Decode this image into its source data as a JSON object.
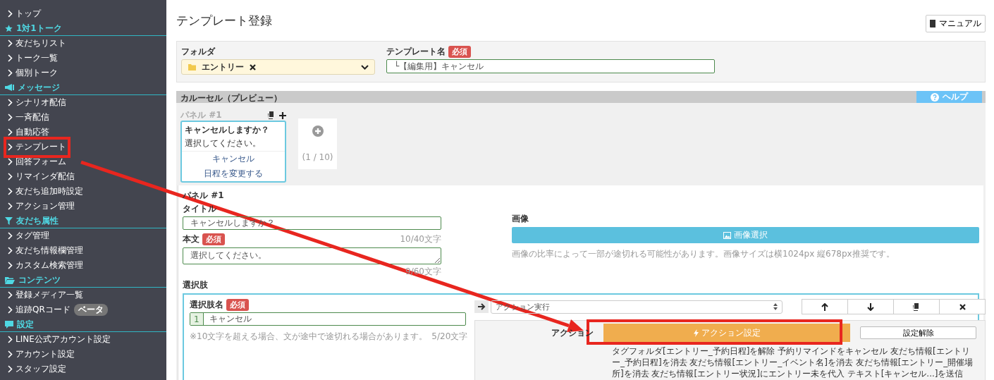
{
  "sidebar": {
    "items": [
      {
        "kind": "link",
        "label": "トップ"
      },
      {
        "kind": "section",
        "label": "1対1トーク"
      },
      {
        "kind": "link",
        "label": "友だちリスト"
      },
      {
        "kind": "link",
        "label": "トーク一覧"
      },
      {
        "kind": "link",
        "label": "個別トーク"
      },
      {
        "kind": "section",
        "label": "メッセージ"
      },
      {
        "kind": "link",
        "label": "シナリオ配信"
      },
      {
        "kind": "link",
        "label": "一斉配信"
      },
      {
        "kind": "link",
        "label": "自動応答"
      },
      {
        "kind": "link",
        "label": "テンプレート"
      },
      {
        "kind": "link",
        "label": "回答フォーム"
      },
      {
        "kind": "link",
        "label": "リマインダ配信"
      },
      {
        "kind": "link",
        "label": "友だち追加時設定"
      },
      {
        "kind": "link",
        "label": "アクション管理"
      },
      {
        "kind": "section",
        "label": "友だち属性"
      },
      {
        "kind": "link",
        "label": "タグ管理"
      },
      {
        "kind": "link",
        "label": "友だち情報欄管理"
      },
      {
        "kind": "link",
        "label": "カスタム検索管理"
      },
      {
        "kind": "section",
        "label": "コンテンツ"
      },
      {
        "kind": "link",
        "label": "登録メディア一覧"
      },
      {
        "kind": "link",
        "label": "追跡QRコード",
        "badge": "ベータ"
      },
      {
        "kind": "section",
        "label": "設定"
      },
      {
        "kind": "link",
        "label": "LINE公式アカウント設定"
      },
      {
        "kind": "link",
        "label": "アカウント設定"
      },
      {
        "kind": "link",
        "label": "スタッフ設定"
      }
    ]
  },
  "page": {
    "title": "テンプレート登録",
    "manual_button": "マニュアル"
  },
  "folder": {
    "label": "フォルダ",
    "value": "エントリー"
  },
  "template_name": {
    "label": "テンプレート名",
    "required": "必須",
    "value": "└【編集用】キャンセル"
  },
  "carousel": {
    "header": "カルーセル（プレビュー）",
    "help_button": "ヘルプ",
    "panel_label": "パネル #1",
    "preview": {
      "title": "キャンセルしますか？",
      "text": "選択してください。",
      "choices": [
        "キャンセル",
        "日程を変更する"
      ]
    },
    "counter": "(1 / 10)"
  },
  "panel": {
    "heading": "パネル #1",
    "title_label": "タイトル",
    "title_value": "キャンセルしますか？",
    "title_count": "10/40文字",
    "body_label": "本文",
    "body_required": "必須",
    "body_value": "選択してください。",
    "body_count": "9/60文字",
    "image_label": "画像",
    "image_button": "画像選択",
    "image_note": "画像の比率によって一部が途切れる可能性があります。画像サイズは横1024px 縦678px推奨です。"
  },
  "choices": {
    "label": "選択肢",
    "name_label": "選択肢名",
    "required": "必須",
    "index": "1",
    "value": "キャンセル",
    "note": "※10文字を超える場合、文が途中で途切れる場合があります。",
    "count": "5/20文字",
    "action_type": "アクション実行",
    "action_label": "アクション",
    "action_button": "アクション設定",
    "clear_button": "設定解除",
    "action_summary": "タグフォルダ[エントリー_予約日程]を解除 予約リマインドをキャンセル 友だち情報[エントリー_予約日程]を消去 友だち情報[エントリー_イベント名]を消去 友だち情報[エントリー_開催場所]を消去 友だち情報[エントリー状況]にエントリー未を代入 テキスト[キャンセル...]を送信"
  }
}
